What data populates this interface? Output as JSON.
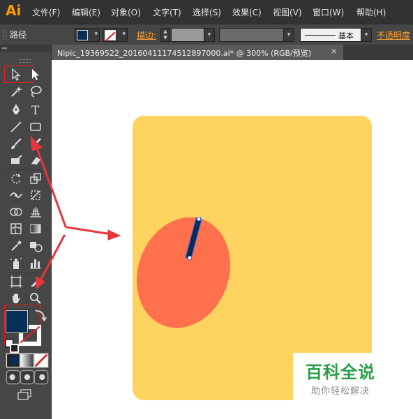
{
  "app": {
    "logo": "Ai"
  },
  "menu": [
    "文件(F)",
    "编辑(E)",
    "对象(O)",
    "文字(T)",
    "选择(S)",
    "效果(C)",
    "视图(V)",
    "窗口(W)",
    "帮助(H)"
  ],
  "control_bar": {
    "selection_type": "路径",
    "fill_color": "#082f55",
    "stroke_label": "描边:",
    "stroke_style": "基本",
    "opacity_label": "不透明度"
  },
  "document": {
    "tab_title": "Nipic_19369522_20160411174512897000.ai*  @  300%  (RGB/预览)",
    "close_glyph": "×"
  },
  "tools": {
    "selection_icon": "selection-arrow-icon",
    "direct_selection_icon": "direct-selection-icon",
    "fill_color": "#082f55",
    "stroke_color": "none"
  },
  "artwork": {
    "board_color": "#ffd35f",
    "egg_color": "#ff704d",
    "stem_color": "#0b2a55"
  },
  "annotation": {
    "arrow_color": "#e8353a"
  },
  "watermark": {
    "main": "百科全说",
    "sub": "助你轻松解决"
  }
}
